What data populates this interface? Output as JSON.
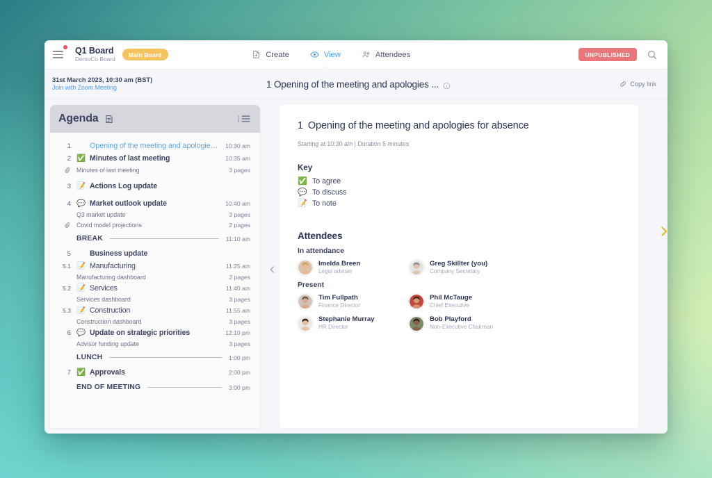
{
  "topbar": {
    "menu_icon": "hamburger-icon",
    "notification_dot": true,
    "board_title": "Q1 Board",
    "board_subtitle": "DemoCo Board",
    "board_tag": "Main Board",
    "tabs": [
      {
        "label": "Create",
        "icon": "document-plus-icon",
        "active": false
      },
      {
        "label": "View",
        "icon": "eye-icon",
        "active": true
      },
      {
        "label": "Attendees",
        "icon": "people-icon",
        "active": false
      }
    ],
    "status_badge": "UNPUBLISHED",
    "search_icon": "search-icon"
  },
  "subbar": {
    "meeting_date": "31st March 2023, 10:30 am (BST)",
    "meeting_link": "Join with Zoom Meeting",
    "section_title": "1 Opening of the meeting and apologies ...",
    "info_icon": "info-circle-icon",
    "copy_link_label": "Copy link",
    "copy_link_icon": "link-icon"
  },
  "agenda": {
    "header_title": "Agenda",
    "edit_icon": "edit-document-icon",
    "list_icon": "numbered-list-icon",
    "items": [
      {
        "kind": "item",
        "num": "1",
        "emoji": "",
        "label": "Opening of the meeting and apologies f...",
        "time": "10:30 am",
        "active": true
      },
      {
        "kind": "item",
        "num": "2",
        "emoji": "✅",
        "label": "Minutes of last meeting",
        "time": "10:35 am",
        "active": false
      },
      {
        "kind": "attachment",
        "label": "Minutes of last meeting",
        "pages": "3 pages"
      },
      {
        "kind": "gap"
      },
      {
        "kind": "item",
        "num": "3",
        "emoji": "📝",
        "label": "Actions Log update",
        "time": "",
        "active": false
      },
      {
        "kind": "gap"
      },
      {
        "kind": "item",
        "num": "4",
        "emoji": "💬",
        "label": "Market outlook update",
        "time": "10:40 am",
        "active": false
      },
      {
        "kind": "subtext",
        "label": "Q3 market update",
        "pages": "3 pages"
      },
      {
        "kind": "attachment",
        "label": "Covid model projections",
        "pages": "2 pages"
      },
      {
        "kind": "divider",
        "label": "BREAK",
        "time": "11:10 am"
      },
      {
        "kind": "item",
        "num": "5",
        "emoji": "",
        "label": "Business update",
        "time": "",
        "active": false
      },
      {
        "kind": "item",
        "num": "5.1",
        "emoji": "📝",
        "label": "Manufacturing",
        "time": "11:25 am",
        "sub": true,
        "plain": true
      },
      {
        "kind": "subtext",
        "label": "Manufacturing dashboard",
        "pages": "2 pages"
      },
      {
        "kind": "item",
        "num": "5.2",
        "emoji": "📝",
        "label": "Services",
        "time": "11:40 am",
        "sub": true,
        "plain": true
      },
      {
        "kind": "subtext",
        "label": "Services dashboard",
        "pages": "3 pages"
      },
      {
        "kind": "item",
        "num": "5.3",
        "emoji": "📝",
        "label": "Construction",
        "time": "11:55 am",
        "sub": true,
        "plain": true
      },
      {
        "kind": "subtext",
        "label": "Construction dashboard",
        "pages": "3 pages"
      },
      {
        "kind": "item",
        "num": "6",
        "emoji": "💬",
        "label": "Update on strategic priorities",
        "time": "12:10 pm",
        "active": false
      },
      {
        "kind": "subtext",
        "label": "Advisor funding update",
        "pages": "3 pages"
      },
      {
        "kind": "divider",
        "label": "LUNCH",
        "time": "1:00 pm"
      },
      {
        "kind": "item",
        "num": "7",
        "emoji": "✅",
        "label": "Approvals",
        "time": "2:00 pm",
        "active": false
      },
      {
        "kind": "divider",
        "label": "END OF MEETING",
        "time": "3:00 pm"
      }
    ]
  },
  "document": {
    "number": "1",
    "title": "Opening of the meeting and apologies for absence",
    "meta": "Starting at 10:30 am | Duration 5 minutes",
    "key_heading": "Key",
    "key_items": [
      {
        "emoji": "✅",
        "label": "To agree"
      },
      {
        "emoji": "💬",
        "label": "To discuss"
      },
      {
        "emoji": "📝",
        "label": "To note"
      }
    ],
    "attendees_heading": "Attendees",
    "groups": [
      {
        "label": "In attendance",
        "people": [
          {
            "name": "Imelda Breen",
            "role": "Legal adviser",
            "skin": "#e8b894",
            "hair": "#c9a063",
            "bg": "#dcc3a8"
          },
          {
            "name": "Greg Skillter (you)",
            "role": "Company Secretary",
            "skin": "#ddc3b0",
            "hair": "#8a8a8a",
            "bg": "#e6e4e0"
          }
        ]
      },
      {
        "label": "Present",
        "people": [
          {
            "name": "Tim Fullpath",
            "role": "Finance Director",
            "skin": "#d8a98c",
            "hair": "#6b5244",
            "bg": "#cfc3bb"
          },
          {
            "name": "Phil McTauge",
            "role": "Chief Executive",
            "skin": "#d49a76",
            "hair": "#3a2a20",
            "bg": "#c4473f"
          },
          {
            "name": "Stephanie Murray",
            "role": "HR Director",
            "skin": "#e3c0a4",
            "hair": "#2b2118",
            "bg": "#e9e7e4"
          },
          {
            "name": "Bob Playford",
            "role": "Non-Executive Chairman",
            "skin": "#8a6347",
            "hair": "#2a2118",
            "bg": "#7c8a6a"
          }
        ]
      }
    ]
  },
  "nav": {
    "prev_icon": "chevron-left-icon",
    "next_icon": "chevron-right-icon",
    "accent_color": "#f0b82f"
  }
}
